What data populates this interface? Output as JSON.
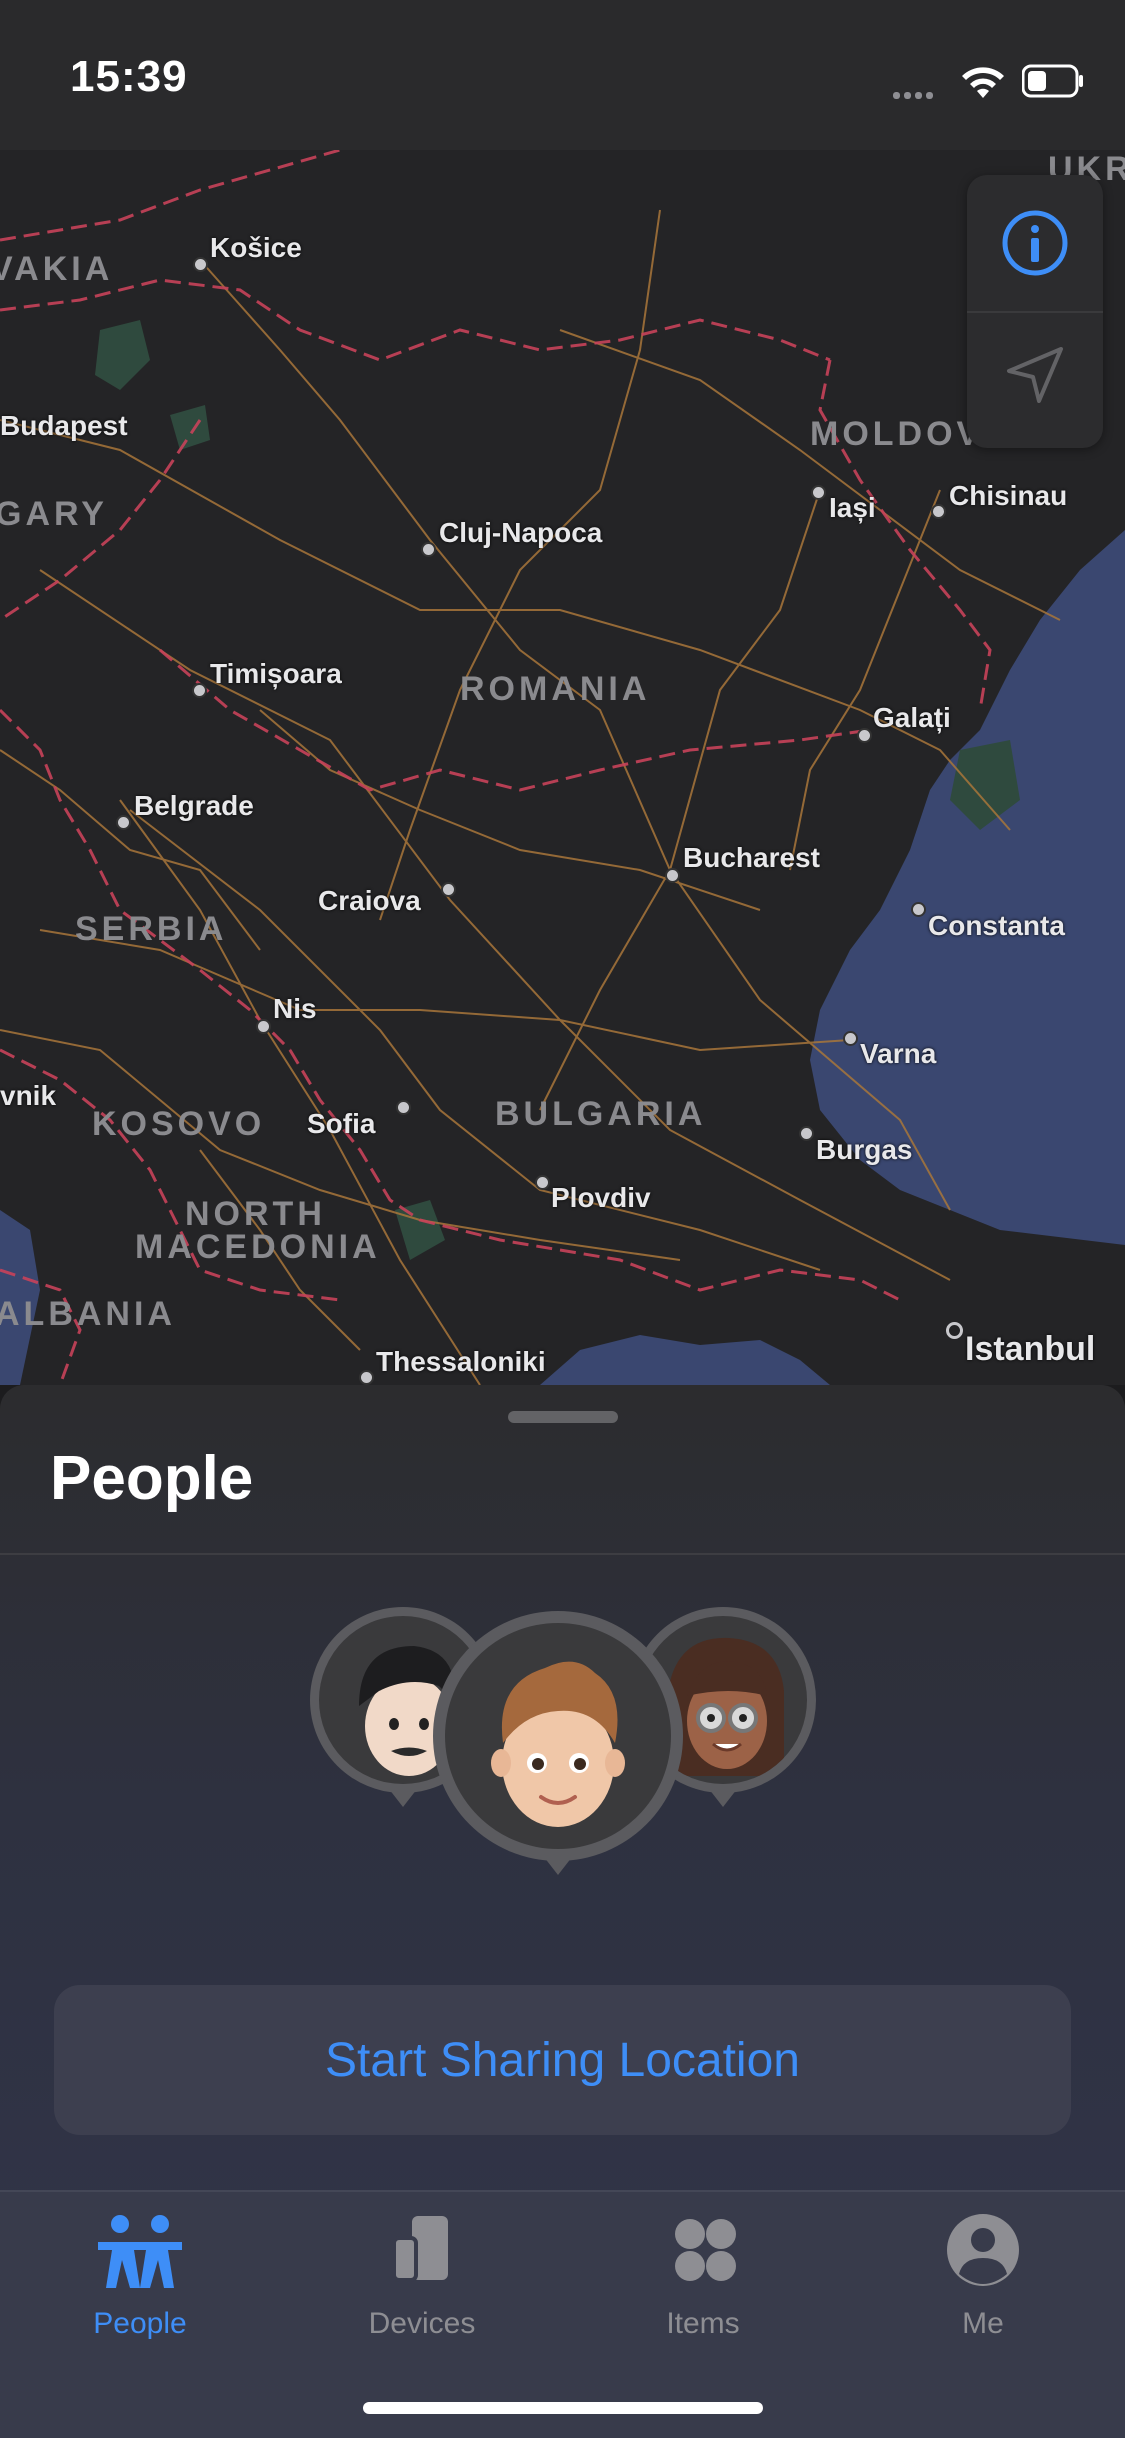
{
  "status_bar": {
    "time": "15:39"
  },
  "map": {
    "cities": [
      {
        "name": "Košice"
      },
      {
        "name": "Budapest"
      },
      {
        "name": "Cluj-Napoca"
      },
      {
        "name": "Iași"
      },
      {
        "name": "Chisinau"
      },
      {
        "name": "Timișoara"
      },
      {
        "name": "Galați"
      },
      {
        "name": "Belgrade"
      },
      {
        "name": "Bucharest"
      },
      {
        "name": "Craiova"
      },
      {
        "name": "Constanta"
      },
      {
        "name": "Nis"
      },
      {
        "name": "Varna"
      },
      {
        "name": "Sofia"
      },
      {
        "name": "Burgas"
      },
      {
        "name": "Plovdiv"
      },
      {
        "name": "Thessaloniki"
      },
      {
        "name": "Istanbul"
      },
      {
        "name": "vnik"
      }
    ],
    "countries": [
      "VAKIA",
      "UKR",
      "MOLDOV",
      "GARY",
      "ROMANIA",
      "SERBIA",
      "KOSOVO",
      "BULGARIA",
      "NORTH",
      "MACEDONIA",
      "ALBANIA"
    ],
    "controls": {
      "info_icon": "info-icon",
      "locate_icon": "location-arrow-icon"
    }
  },
  "sheet": {
    "title": "People",
    "share_button": "Start Sharing Location"
  },
  "tabs": [
    {
      "label": "People",
      "icon": "people-icon",
      "active": true
    },
    {
      "label": "Devices",
      "icon": "devices-icon",
      "active": false
    },
    {
      "label": "Items",
      "icon": "items-icon",
      "active": false
    },
    {
      "label": "Me",
      "icon": "me-icon",
      "active": false
    }
  ],
  "colors": {
    "accent": "#3e8ef7",
    "map_background": "#242426",
    "sea": "#3a4770",
    "border": "#c8425a",
    "road": "#a8763a"
  }
}
